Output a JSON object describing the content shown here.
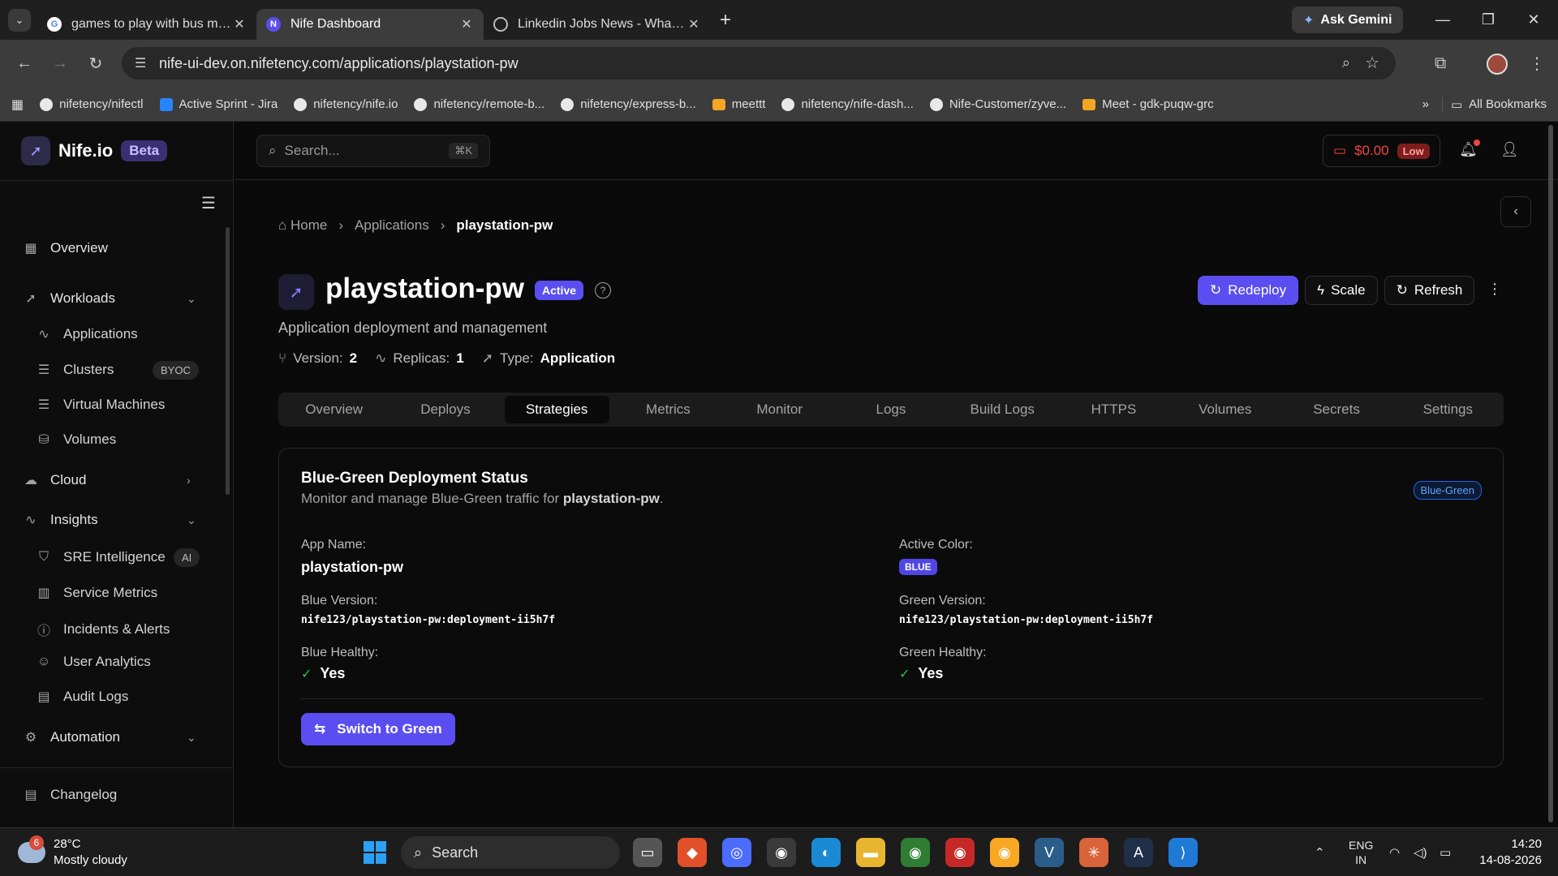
{
  "browser": {
    "tabs": [
      {
        "title": "games to play with bus mates -",
        "icon": "google-icon",
        "active": false
      },
      {
        "title": "Nife Dashboard",
        "icon": "nife-icon",
        "active": true
      },
      {
        "title": "Linkedin Jobs News - WhatsApp",
        "icon": "whatsapp-icon",
        "active": false
      }
    ],
    "gemini_label": "Ask Gemini",
    "url": "nife-ui-dev.on.nifetency.com/applications/playstation-pw",
    "bookmarks": [
      {
        "label": "nifetency/nifectl",
        "icon": "github-icon"
      },
      {
        "label": "Active Sprint - Jira",
        "icon": "jira-icon"
      },
      {
        "label": "nifetency/nife.io",
        "icon": "github-icon"
      },
      {
        "label": "nifetency/remote-b...",
        "icon": "github-icon"
      },
      {
        "label": "nifetency/express-b...",
        "icon": "github-icon"
      },
      {
        "label": "meettt",
        "icon": "meet-icon"
      },
      {
        "label": "nifetency/nife-dash...",
        "icon": "github-icon"
      },
      {
        "label": "Nife-Customer/zyve...",
        "icon": "github-icon"
      },
      {
        "label": "Meet - gdk-puqw-grc",
        "icon": "meet-icon"
      }
    ],
    "all_bookmarks": "All Bookmarks"
  },
  "brand": {
    "name": "Nife.io",
    "badge": "Beta"
  },
  "sidebar": {
    "overview": "Overview",
    "workloads": "Workloads",
    "applications": "Applications",
    "clusters": "Clusters",
    "clusters_badge": "BYOC",
    "virtual_machines": "Virtual Machines",
    "volumes": "Volumes",
    "cloud": "Cloud",
    "insights": "Insights",
    "sre": "SRE Intelligence",
    "sre_badge": "AI",
    "service_metrics": "Service Metrics",
    "incidents": "Incidents & Alerts",
    "user_analytics": "User Analytics",
    "audit_logs": "Audit Logs",
    "automation": "Automation",
    "changelog": "Changelog"
  },
  "topbar": {
    "search_placeholder": "Search...",
    "shortcut": "⌘K",
    "balance": "$0.00",
    "balance_status": "Low"
  },
  "breadcrumb": {
    "home": "Home",
    "applications": "Applications",
    "current": "playstation-pw"
  },
  "app": {
    "name": "playstation-pw",
    "status": "Active",
    "subtitle": "Application deployment and management",
    "version_label": "Version:",
    "version": "2",
    "replicas_label": "Replicas:",
    "replicas": "1",
    "type_label": "Type:",
    "type": "Application"
  },
  "actions": {
    "redeploy": "Redeploy",
    "scale": "Scale",
    "refresh": "Refresh"
  },
  "tabs": [
    "Overview",
    "Deploys",
    "Strategies",
    "Metrics",
    "Monitor",
    "Logs",
    "Build Logs",
    "HTTPS",
    "Volumes",
    "Secrets",
    "Settings"
  ],
  "active_tab": "Strategies",
  "card": {
    "title": "Blue-Green Deployment Status",
    "desc_prefix": "Monitor and manage Blue-Green traffic for",
    "desc_app": "playstation-pw",
    "desc_suffix": ".",
    "tag": "Blue-Green",
    "app_name_label": "App Name:",
    "app_name": "playstation-pw",
    "active_color_label": "Active Color:",
    "active_color": "BLUE",
    "blue_version_label": "Blue Version:",
    "blue_version": "nife123/playstation-pw:deployment-ii5h7f",
    "green_version_label": "Green Version:",
    "green_version": "nife123/playstation-pw:deployment-ii5h7f",
    "blue_healthy_label": "Blue Healthy:",
    "blue_healthy": "Yes",
    "green_healthy_label": "Green Healthy:",
    "green_healthy": "Yes",
    "switch_button": "Switch to Green"
  },
  "taskbar": {
    "weather_badge": "6",
    "temp": "28°C",
    "weather": "Mostly cloudy",
    "search": "Search",
    "lang": "ENG",
    "region": "IN",
    "time": "14:20",
    "date": "14-08-2026"
  },
  "colors": {
    "accent": "#5b4ef0",
    "danger": "#ef4444",
    "success": "#22c55e"
  }
}
